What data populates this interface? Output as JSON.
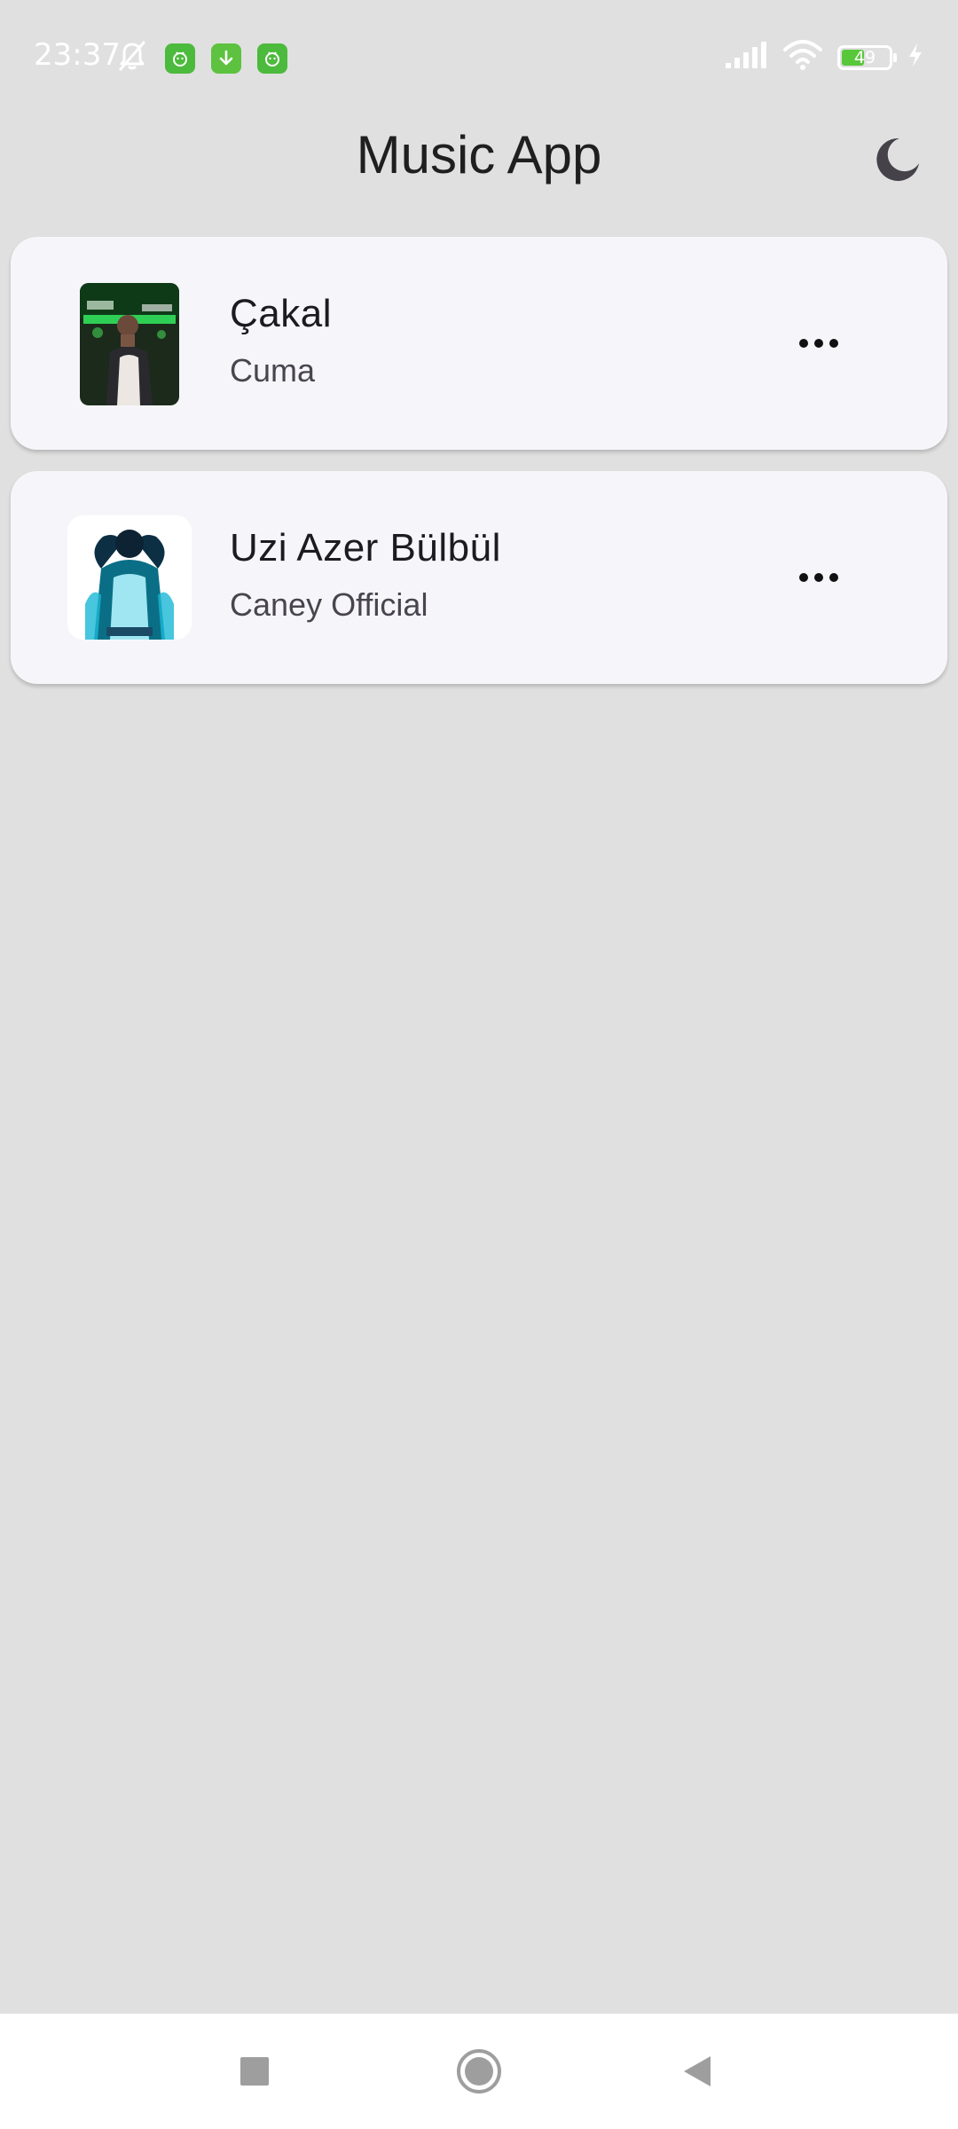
{
  "status_bar": {
    "time": "23:37",
    "battery_level": "49",
    "battery_fraction": 0.49,
    "icons": [
      "mute-bell-icon",
      "android-app-icon",
      "download-icon",
      "android-app-icon",
      "signal-icon",
      "wifi-icon",
      "battery-icon",
      "charging-bolt-icon"
    ]
  },
  "header": {
    "title": "Music App",
    "theme_icon": "moon-icon"
  },
  "songs": [
    {
      "title": "Çakal",
      "artist": "Cuma",
      "menu_icon": "more-horizontal-icon"
    },
    {
      "title": "Uzi Azer Bülbül",
      "artist": "Caney Official",
      "menu_icon": "more-horizontal-icon"
    }
  ],
  "nav_bar": {
    "buttons": [
      "recents-square-icon",
      "home-circle-icon",
      "back-triangle-icon"
    ]
  },
  "colors": {
    "background": "#e0e0e0",
    "card": "#f6f6fa",
    "title_text": "#1c1b1f",
    "subtitle_text": "#49454f",
    "status_green": "#4cba3c"
  }
}
